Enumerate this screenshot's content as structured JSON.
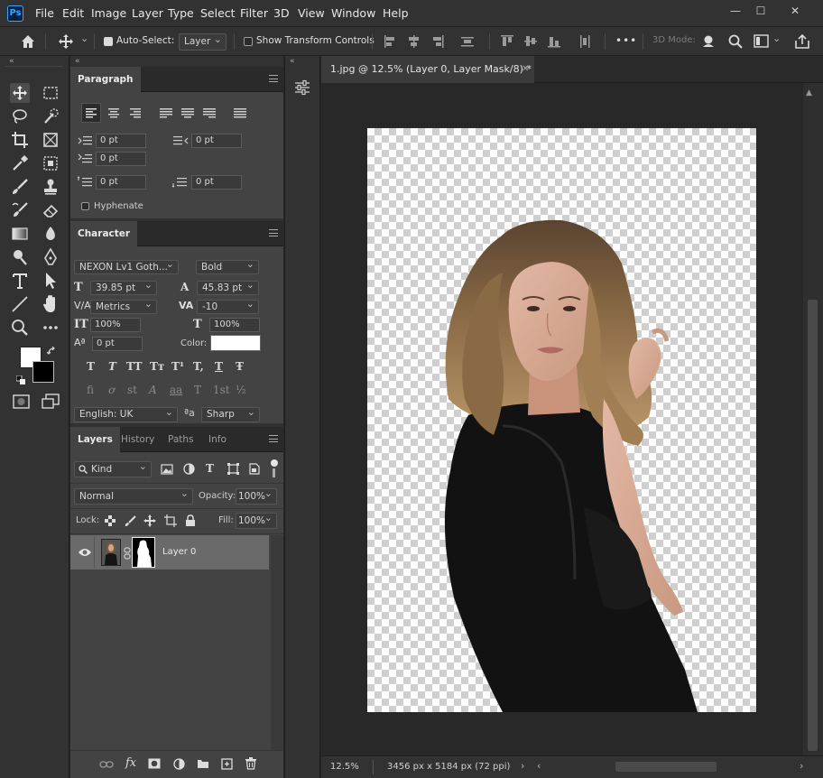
{
  "app": {
    "logo": "Ps"
  },
  "menu": [
    "File",
    "Edit",
    "Image",
    "Layer",
    "Type",
    "Select",
    "Filter",
    "3D",
    "View",
    "Window",
    "Help"
  ],
  "window_controls": {
    "minimize": "—",
    "maximize": "☐",
    "close": "✕"
  },
  "options": {
    "auto_select_label": "Auto-Select:",
    "auto_select_checked": true,
    "auto_select_target": "Layer",
    "show_transform_label": "Show Transform Controls",
    "show_transform_checked": false,
    "more": "•••",
    "mode_3d_label": "3D Mode:"
  },
  "paragraph": {
    "tab": "Paragraph",
    "indent_left": "0 pt",
    "indent_right": "0 pt",
    "indent_first": "0 pt",
    "space_before": "0 pt",
    "space_after": "0 pt",
    "hyphenate_label": "Hyphenate",
    "hyphenate_checked": false
  },
  "character": {
    "tab": "Character",
    "font_family": "NEXON Lv1 Goth...",
    "font_style": "Bold",
    "font_size": "39.85 pt",
    "leading": "45.83 pt",
    "kerning": "Metrics",
    "tracking": "-10",
    "vertical_scale": "100%",
    "horizontal_scale": "100%",
    "baseline_shift": "0 pt",
    "color_label": "Color:",
    "color_value": "#ffffff",
    "style_buttons": [
      "T",
      "T",
      "TT",
      "Tт",
      "T¹",
      "T,",
      "T",
      "Ŧ"
    ],
    "opentype_buttons": [
      "fi",
      "ơ",
      "st",
      "A",
      "aa",
      "T",
      "1st",
      "½"
    ],
    "language": "English: UK",
    "aa_label": "ªa",
    "antialias": "Sharp"
  },
  "layers": {
    "tabs": [
      "Layers",
      "History",
      "Paths",
      "Info"
    ],
    "filter_kind": "Kind",
    "blend_mode": "Normal",
    "opacity_label": "Opacity:",
    "opacity": "100%",
    "lock_label": "Lock:",
    "fill_label": "Fill:",
    "fill": "100%",
    "items": [
      {
        "name": "Layer 0",
        "visible": true,
        "has_mask": true
      }
    ],
    "bottom_fx": "fx"
  },
  "document": {
    "tab_title": "1.jpg @ 12.5% (Layer 0, Layer Mask/8) *",
    "zoom": "12.5%",
    "doc_info": "3456 px x 5184 px (72 ppi)"
  },
  "colors": {
    "foreground": "#ffffff",
    "background": "#000000",
    "accent": "#31a8ff"
  }
}
